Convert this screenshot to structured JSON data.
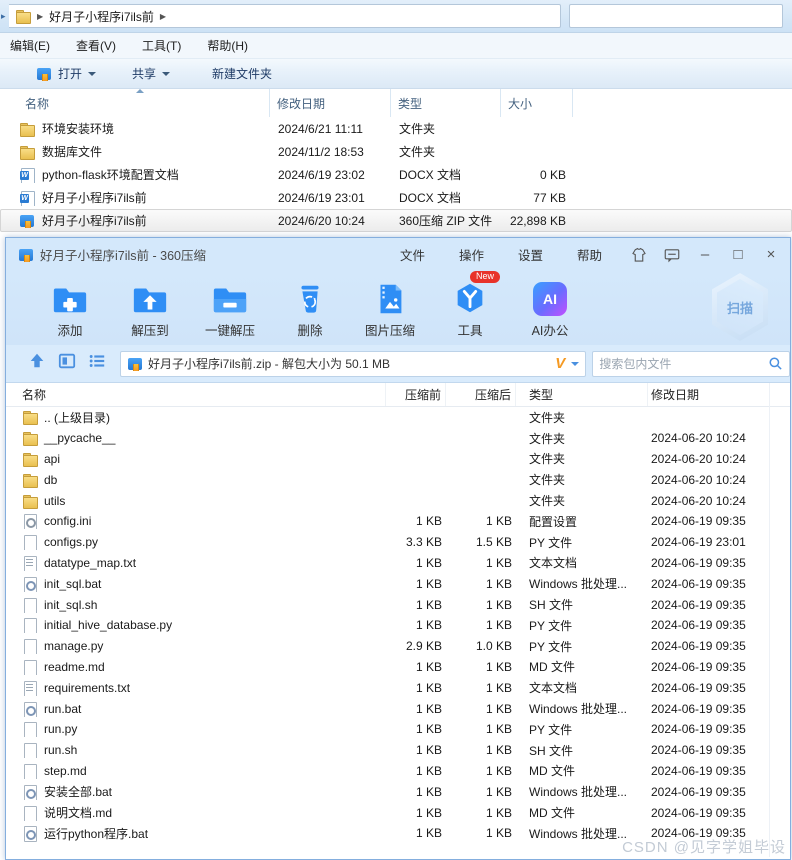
{
  "watermark": "CSDN @见字学姐毕设",
  "explorer": {
    "breadcrumb": {
      "path": "好月子小程序i7ils前"
    },
    "menu": [
      "编辑(E)",
      "查看(V)",
      "工具(T)",
      "帮助(H)"
    ],
    "toolbar": {
      "open": "打开",
      "share": "共享",
      "new_folder": "新建文件夹"
    },
    "columns": {
      "name": "名称",
      "date": "修改日期",
      "type": "类型",
      "size": "大小"
    },
    "rows": [
      {
        "name": "环境安装环境",
        "icon": "folder",
        "date": "2024/6/21 11:11",
        "type": "文件夹",
        "size": ""
      },
      {
        "name": "数据库文件",
        "icon": "folder",
        "date": "2024/11/2 18:53",
        "type": "文件夹",
        "size": ""
      },
      {
        "name": "python-flask环境配置文档",
        "icon": "docx",
        "date": "2024/6/19 23:02",
        "type": "DOCX 文档",
        "size": "0 KB"
      },
      {
        "name": "好月子小程序i7ils前",
        "icon": "docx",
        "date": "2024/6/19 23:01",
        "type": "DOCX 文档",
        "size": "77 KB"
      },
      {
        "name": "好月子小程序i7ils前",
        "icon": "zip",
        "date": "2024/6/20 10:24",
        "type": "360压缩 ZIP 文件",
        "size": "22,898 KB",
        "selected": true
      }
    ]
  },
  "zip": {
    "title": "好月子小程序i7ils前 - 360压缩",
    "menu": [
      "文件",
      "操作",
      "设置",
      "帮助"
    ],
    "toolbar": [
      {
        "label": "添加"
      },
      {
        "label": "解压到"
      },
      {
        "label": "一键解压"
      },
      {
        "label": "删除"
      },
      {
        "label": "图片压缩"
      },
      {
        "label": "工具",
        "badge": "New"
      },
      {
        "label": "AI办公"
      }
    ],
    "ai_icon_text": "AI",
    "scan_label": "扫描",
    "address": "好月子小程序i7ils前.zip - 解包大小为 50.1 MB",
    "v_logo": "V",
    "search_placeholder": "搜索包内文件",
    "columns": {
      "name": "名称",
      "before": "压缩前",
      "after": "压缩后",
      "type": "类型",
      "date": "修改日期"
    },
    "rows": [
      {
        "name": ".. (上级目录)",
        "icon": "folder",
        "before": "",
        "after": "",
        "type": "文件夹",
        "date": ""
      },
      {
        "name": "__pycache__",
        "icon": "folder",
        "before": "",
        "after": "",
        "type": "文件夹",
        "date": "2024-06-20 10:24"
      },
      {
        "name": "api",
        "icon": "folder",
        "before": "",
        "after": "",
        "type": "文件夹",
        "date": "2024-06-20 10:24"
      },
      {
        "name": "db",
        "icon": "folder",
        "before": "",
        "after": "",
        "type": "文件夹",
        "date": "2024-06-20 10:24"
      },
      {
        "name": "utils",
        "icon": "folder",
        "before": "",
        "after": "",
        "type": "文件夹",
        "date": "2024-06-20 10:24"
      },
      {
        "name": "config.ini",
        "icon": "config",
        "before": "1 KB",
        "after": "1 KB",
        "type": "配置设置",
        "date": "2024-06-19 09:35"
      },
      {
        "name": "configs.py",
        "icon": "doc",
        "before": "3.3 KB",
        "after": "1.5 KB",
        "type": "PY 文件",
        "date": "2024-06-19 23:01"
      },
      {
        "name": "datatype_map.txt",
        "icon": "txt",
        "before": "1 KB",
        "after": "1 KB",
        "type": "文本文档",
        "date": "2024-06-19 09:35"
      },
      {
        "name": "init_sql.bat",
        "icon": "bat",
        "before": "1 KB",
        "after": "1 KB",
        "type": "Windows 批处理...",
        "date": "2024-06-19 09:35"
      },
      {
        "name": "init_sql.sh",
        "icon": "doc",
        "before": "1 KB",
        "after": "1 KB",
        "type": "SH 文件",
        "date": "2024-06-19 09:35"
      },
      {
        "name": "initial_hive_database.py",
        "icon": "doc",
        "before": "1 KB",
        "after": "1 KB",
        "type": "PY 文件",
        "date": "2024-06-19 09:35"
      },
      {
        "name": "manage.py",
        "icon": "doc",
        "before": "2.9 KB",
        "after": "1.0 KB",
        "type": "PY 文件",
        "date": "2024-06-19 09:35"
      },
      {
        "name": "readme.md",
        "icon": "doc",
        "before": "1 KB",
        "after": "1 KB",
        "type": "MD 文件",
        "date": "2024-06-19 09:35"
      },
      {
        "name": "requirements.txt",
        "icon": "txt",
        "before": "1 KB",
        "after": "1 KB",
        "type": "文本文档",
        "date": "2024-06-19 09:35"
      },
      {
        "name": "run.bat",
        "icon": "bat",
        "before": "1 KB",
        "after": "1 KB",
        "type": "Windows 批处理...",
        "date": "2024-06-19 09:35"
      },
      {
        "name": "run.py",
        "icon": "doc",
        "before": "1 KB",
        "after": "1 KB",
        "type": "PY 文件",
        "date": "2024-06-19 09:35"
      },
      {
        "name": "run.sh",
        "icon": "doc",
        "before": "1 KB",
        "after": "1 KB",
        "type": "SH 文件",
        "date": "2024-06-19 09:35"
      },
      {
        "name": "step.md",
        "icon": "doc",
        "before": "1 KB",
        "after": "1 KB",
        "type": "MD 文件",
        "date": "2024-06-19 09:35"
      },
      {
        "name": "安装全部.bat",
        "icon": "bat",
        "before": "1 KB",
        "after": "1 KB",
        "type": "Windows 批处理...",
        "date": "2024-06-19 09:35"
      },
      {
        "name": "说明文档.md",
        "icon": "doc",
        "before": "1 KB",
        "after": "1 KB",
        "type": "MD 文件",
        "date": "2024-06-19 09:35"
      },
      {
        "name": "运行python程序.bat",
        "icon": "bat",
        "before": "1 KB",
        "after": "1 KB",
        "type": "Windows 批处理...",
        "date": "2024-06-19 09:35"
      }
    ]
  }
}
